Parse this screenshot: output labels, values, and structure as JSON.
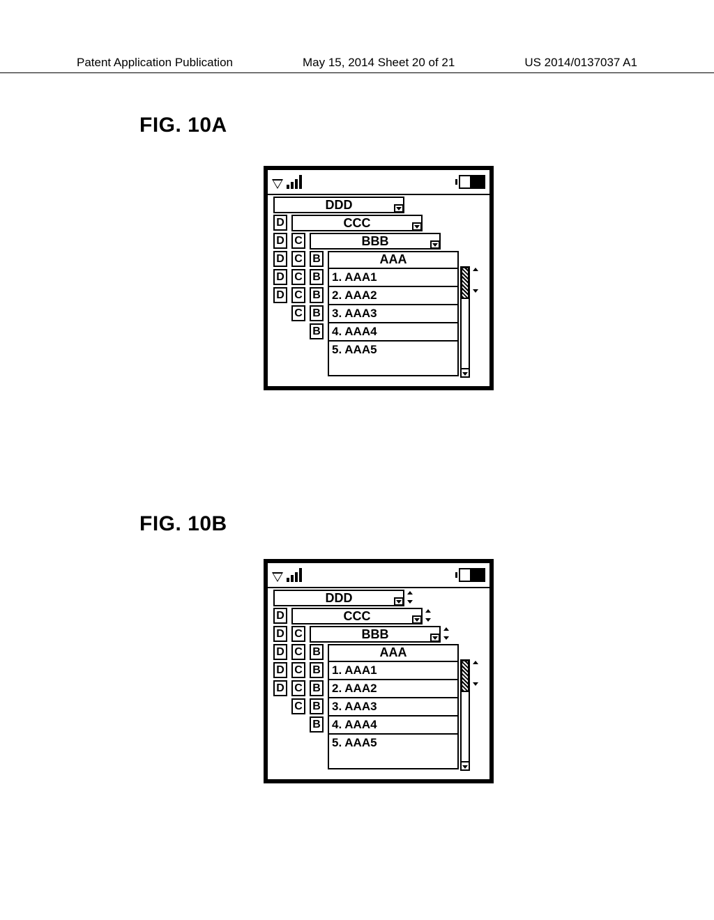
{
  "header": {
    "left": "Patent Application Publication",
    "center": "May 15, 2014  Sheet 20 of 21",
    "right": "US 2014/0137037 A1"
  },
  "figA": {
    "label": "FIG. 10A"
  },
  "figB": {
    "label": "FIG. 10B"
  },
  "layers": {
    "ddd": {
      "title": "DDD",
      "tab": "D"
    },
    "ccc": {
      "title": "CCC",
      "tab": "C"
    },
    "bbb": {
      "title": "BBB",
      "tab": "B"
    },
    "aaa": {
      "title": "AAA",
      "items": [
        "1. AAA1",
        "2. AAA2",
        "3. AAA3",
        "4. AAA4",
        "5. AAA5"
      ]
    }
  }
}
